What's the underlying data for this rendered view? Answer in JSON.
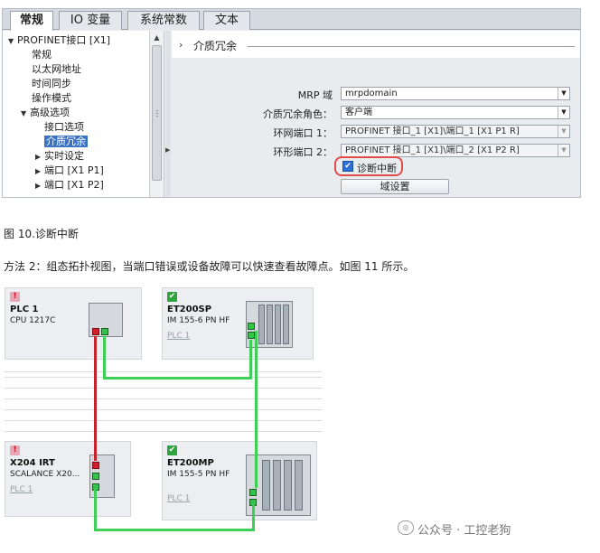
{
  "dialog": {
    "tabs": [
      {
        "label": "常规",
        "active": true
      },
      {
        "label": "IO 变量",
        "active": false
      },
      {
        "label": "系统常数",
        "active": false
      },
      {
        "label": "文本",
        "active": false
      }
    ],
    "tree": [
      {
        "label": "PROFINET接口 [X1]",
        "arrow": "▼",
        "selected": false
      },
      {
        "label": "常规",
        "arrow": "",
        "selected": false
      },
      {
        "label": "以太网地址",
        "arrow": "",
        "selected": false
      },
      {
        "label": "时间同步",
        "arrow": "",
        "selected": false
      },
      {
        "label": "操作模式",
        "arrow": "",
        "selected": false
      },
      {
        "label": "高级选项",
        "arrow": "▼",
        "selected": false
      },
      {
        "label": "接口选项",
        "arrow": "",
        "selected": false
      },
      {
        "label": "介质冗余",
        "arrow": "",
        "selected": true
      },
      {
        "label": "实时设定",
        "arrow": "▶",
        "selected": false
      },
      {
        "label": "端口 [X1 P1]",
        "arrow": "▶",
        "selected": false
      },
      {
        "label": "端口 [X1 P2]",
        "arrow": "▶",
        "selected": false
      }
    ],
    "section_title": "介质冗余",
    "fields": [
      {
        "label": "MRP 域",
        "value": "mrpdomain",
        "disabled": false
      },
      {
        "label": "介质冗余角色：",
        "value": "客户端",
        "disabled": false
      },
      {
        "label": "环网端口 1：",
        "value": "PROFINET 接口_1 [X1]\\端口_1 [X1 P1 R]",
        "disabled": true
      },
      {
        "label": "环形端口 2：",
        "value": "PROFINET 接口_1 [X1]\\端口_2 [X1 P2 R]",
        "disabled": true
      }
    ],
    "diagnostic_interrupt": {
      "label": "诊断中断",
      "checked": true
    },
    "domain_settings_button": "域设置"
  },
  "caption1": "图 10.诊断中断",
  "caption2": "方法 2：组态拓扑视图，当端口错误或设备故障可以快速查看故障点。如图 11 所示。",
  "topology": {
    "devices": [
      {
        "name": "PLC 1",
        "type": "CPU 1217C",
        "network": "",
        "status": "error"
      },
      {
        "name": "ET200SP",
        "type": "IM 155-6 PN HF",
        "network": "PLC 1",
        "status": "ok"
      },
      {
        "name": "X204 IRT",
        "type": "SCALANCE X20...",
        "network": "PLC 1",
        "status": "error"
      },
      {
        "name": "ET200MP",
        "type": "IM 155-5 PN HF",
        "network": "PLC 1",
        "status": "ok"
      }
    ],
    "colors": {
      "link_ok": "#3fcf57",
      "link_error": "#c7232c"
    }
  },
  "watermark": "公众号 · 工控老狗"
}
